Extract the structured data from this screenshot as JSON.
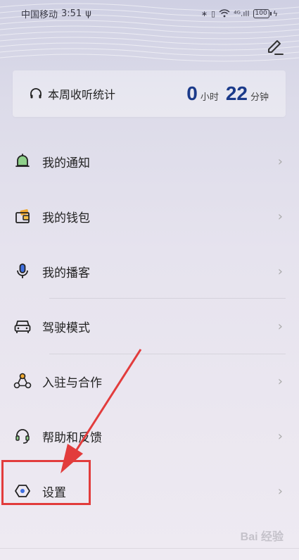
{
  "status_bar": {
    "carrier": "中国移动",
    "time": "3:51",
    "usb": "ψ",
    "bluetooth": "∗",
    "vibrate": "▯",
    "signal": "⁴ᴳ.ıll",
    "battery": "100"
  },
  "stats": {
    "title": "本周收听统计",
    "hours": "0",
    "hours_unit": "小时",
    "minutes": "22",
    "minutes_unit": "分钟"
  },
  "menu": [
    {
      "label": "我的通知",
      "icon": "bell-icon"
    },
    {
      "label": "我的钱包",
      "icon": "wallet-icon"
    },
    {
      "label": "我的播客",
      "icon": "microphone-icon"
    },
    {
      "label": "驾驶模式",
      "icon": "car-icon"
    },
    {
      "label": "入驻与合作",
      "icon": "partnership-icon"
    },
    {
      "label": "帮助和反馈",
      "icon": "headset-icon"
    },
    {
      "label": "设置",
      "icon": "settings-icon"
    }
  ],
  "chevron": "›",
  "watermark": "Bai 经验",
  "colors": {
    "accent": "#1b3a8a",
    "highlight": "#e23c3c"
  }
}
